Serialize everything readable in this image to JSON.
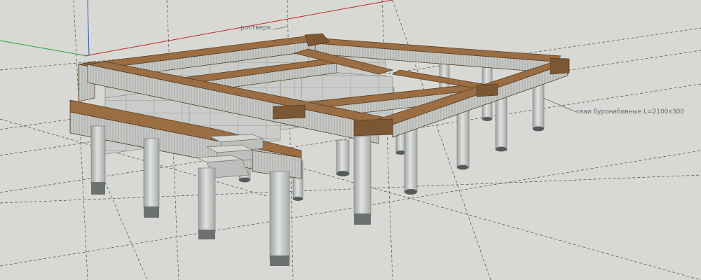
{
  "labels": {
    "grillage": "ростверк",
    "piles": "сваи буронабивные L=2100x300"
  },
  "colors": {
    "background": "#d8d9d4",
    "concrete": "#c9ccc8",
    "wood_beam": "#8a6440",
    "wood_top": "#9a6d43",
    "pile_tip": "#55595a",
    "axis_red": "#c0262a",
    "axis_green": "#2ea13a"
  },
  "icons": {
    "view": "3d-model-view-icon"
  }
}
